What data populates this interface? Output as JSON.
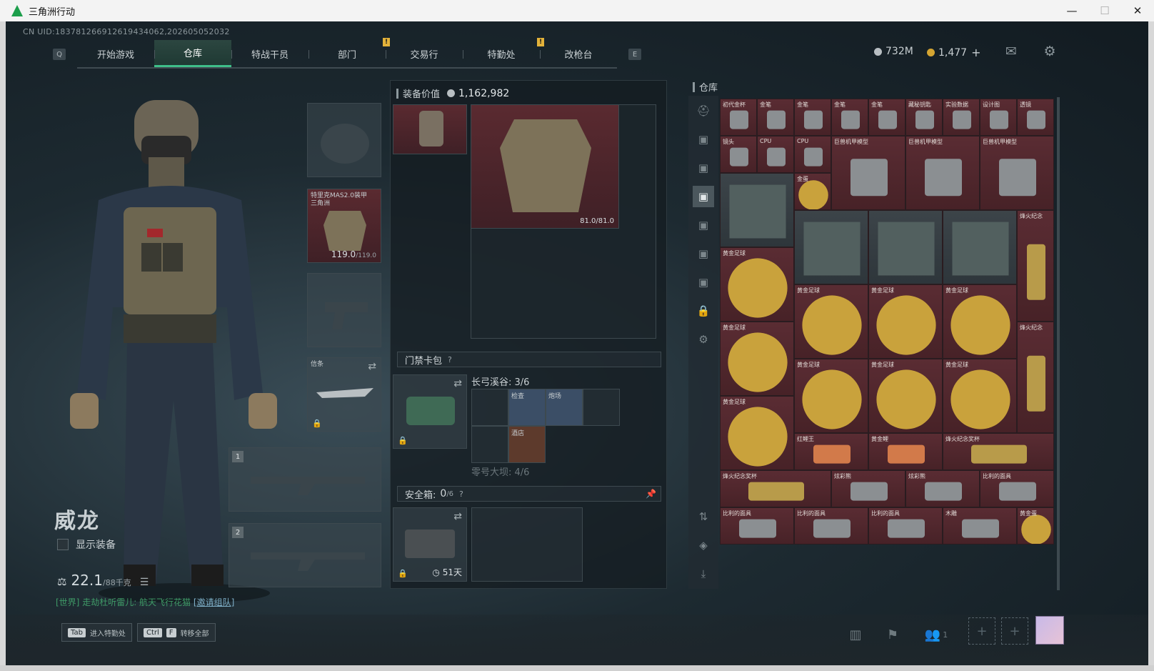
{
  "window": {
    "title": "三角洲行动",
    "controls": [
      "—",
      "☐",
      "✕"
    ]
  },
  "uid": "CN UID:18378126691261943406​2,202605052032",
  "nav": {
    "left_key": "Q",
    "right_key": "E",
    "tabs": [
      {
        "label": "开始游戏",
        "active": false,
        "alert": ""
      },
      {
        "label": "仓库",
        "active": true,
        "alert": ""
      },
      {
        "label": "特战干员",
        "active": false,
        "alert": ""
      },
      {
        "label": "部门",
        "active": false,
        "alert": "!"
      },
      {
        "label": "交易行",
        "active": false,
        "alert": ""
      },
      {
        "label": "特勤处",
        "active": false,
        "alert": "!"
      },
      {
        "label": "改枪台",
        "active": false,
        "alert": ""
      }
    ]
  },
  "currency": {
    "silver": "732M",
    "gold": "1,477",
    "plus": "+"
  },
  "character": {
    "name": "威龙",
    "show_equipment": "显示装备",
    "weight_value": "22.1",
    "weight_unit": "/88千克",
    "chat_channel": "[世界]",
    "chat_text": "走劫杜听雷儿: 航天飞行花猫 ",
    "chat_link": "[邀请组队]"
  },
  "slots": {
    "armor_label": "特里克MAS2.0装甲",
    "armor_sub": "三角洲",
    "armor_value": "119.0",
    "armor_max": "/119.0",
    "melee_label": "信条",
    "slot1": "1",
    "slot2": "2"
  },
  "mid": {
    "equip_value_label": "装备价值",
    "equip_value": "1,162,982",
    "vest_value": "81.0/81.0",
    "keycard_label": "门禁卡包",
    "keycard_q": "?",
    "map1": "长弓溪谷: 3/6",
    "map2": "零号大坝: 4/6",
    "card1": "检查",
    "card2": "炮场",
    "card3": "酒店",
    "safe_label": "安全箱:",
    "safe_count": "0",
    "safe_max": "/6",
    "safe_q": "?",
    "safe_days": "51天"
  },
  "inventory": {
    "title": "仓库",
    "items": [
      {
        "label": "初代金杯",
        "tone": "red"
      },
      {
        "label": "金笔",
        "tone": "red"
      },
      {
        "label": "金笔",
        "tone": "red"
      },
      {
        "label": "金笔",
        "tone": "red"
      },
      {
        "label": "金笔",
        "tone": "red"
      },
      {
        "label": "藏秘钥匙",
        "tone": "red"
      },
      {
        "label": "实验数据",
        "tone": "red"
      },
      {
        "label": "设计图",
        "tone": "red"
      },
      {
        "label": "透镜",
        "tone": "red"
      },
      {
        "label": "镜头",
        "tone": "red"
      },
      {
        "label": "CPU",
        "tone": "red"
      },
      {
        "label": "CPU",
        "tone": "red"
      },
      {
        "label": "巨兽机甲模型",
        "tone": "red"
      },
      {
        "label": "巨兽机甲模型",
        "tone": "red"
      },
      {
        "label": "巨兽机甲模型",
        "tone": "red"
      },
      {
        "label": "",
        "tone": "gray"
      },
      {
        "label": "金蛋",
        "tone": "red"
      },
      {
        "label": "",
        "tone": "gray"
      },
      {
        "label": "",
        "tone": "gray"
      },
      {
        "label": "",
        "tone": "gray"
      },
      {
        "label": "烽火纪念",
        "tone": "red"
      },
      {
        "label": "黄金足球",
        "tone": "red"
      },
      {
        "label": "黄金足球",
        "tone": "red"
      },
      {
        "label": "黄金足球",
        "tone": "red"
      },
      {
        "label": "黄金足球",
        "tone": "red"
      },
      {
        "label": "黄金足球",
        "tone": "red"
      },
      {
        "label": "黄金足球",
        "tone": "red"
      },
      {
        "label": "黄金足球",
        "tone": "red"
      },
      {
        "label": "黄金足球",
        "tone": "red"
      },
      {
        "label": "烽火纪念",
        "tone": "red"
      },
      {
        "label": "黄金足球",
        "tone": "red"
      },
      {
        "label": "红鲤王",
        "tone": "red"
      },
      {
        "label": "黄金鲤",
        "tone": "red"
      },
      {
        "label": "烽火纪念奖杯",
        "tone": "red"
      },
      {
        "label": "烽火纪念奖杯",
        "tone": "red"
      },
      {
        "label": "炫彩熊",
        "tone": "red"
      },
      {
        "label": "炫彩熊",
        "tone": "red"
      },
      {
        "label": "比利的面具",
        "tone": "red"
      },
      {
        "label": "比利的面具",
        "tone": "red"
      },
      {
        "label": "比利的面具",
        "tone": "red"
      },
      {
        "label": "比利的面具",
        "tone": "red"
      },
      {
        "label": "木雕",
        "tone": "red"
      },
      {
        "label": "黄金蛋",
        "tone": "red"
      }
    ]
  },
  "bottom": {
    "hint1_key": "Tab",
    "hint1_text": "进入特勤处",
    "hint2_key1": "Ctrl",
    "hint2_key2": "F",
    "hint2_text": "转移全部",
    "squad_count": "1"
  }
}
